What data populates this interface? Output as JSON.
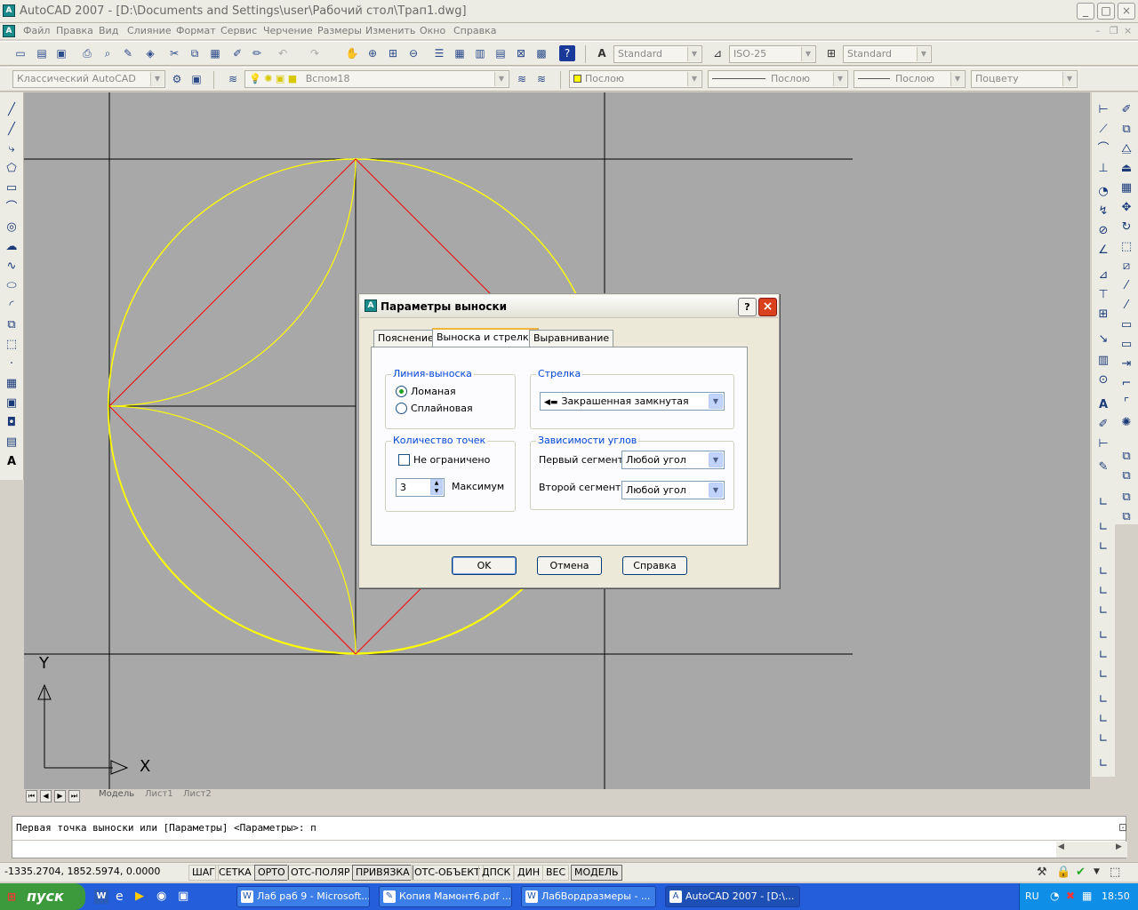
{
  "app": {
    "title": "AutoCAD 2007 - [D:\\Documents and Settings\\user\\Рабочий стол\\Трап1.dwg]",
    "icon": "autocad-app-icon"
  },
  "menu": [
    "Файл",
    "Правка",
    "Вид",
    "Слияние",
    "Формат",
    "Сервис",
    "Черчение",
    "Размеры",
    "Изменить",
    "Окно",
    "Справка"
  ],
  "toolbar": {
    "text_style": "Standard",
    "dim_style": "ISO-25",
    "table_style": "Standard",
    "workspace": "Классический AutoCAD",
    "layer": "Вспом18",
    "color": "Послою",
    "linetype": "Послою",
    "lineweight": "Послою",
    "plotstyle": "Поцвету"
  },
  "layout_tabs": [
    "Модель",
    "Лист1",
    "Лист2"
  ],
  "ucs": {
    "y": "Y",
    "x": "X"
  },
  "command_line": "Первая точка выноски или [Параметры] <Параметры>: п",
  "status": {
    "coords": "-1335.2704, 1852.5974, 0.0000",
    "buttons": [
      {
        "label": "ШАГ",
        "on": false
      },
      {
        "label": "СЕТКА",
        "on": false
      },
      {
        "label": "ОРТО",
        "on": true
      },
      {
        "label": "ОТС-ПОЛЯР",
        "on": false
      },
      {
        "label": "ПРИВЯЗКА",
        "on": true
      },
      {
        "label": "ОТС-ОБЪЕКТ",
        "on": false
      },
      {
        "label": "ДПСК",
        "on": false
      },
      {
        "label": "ДИН",
        "on": false
      },
      {
        "label": "ВЕС",
        "on": false
      },
      {
        "label": "МОДЕЛЬ",
        "on": true
      }
    ]
  },
  "taskbar": {
    "start": "пуск",
    "tasks": [
      "Лаб раб 9 - Microsoft...",
      "Копия Мамонт6.pdf ...",
      "ЛабВордразмеры - ...",
      "AutoCAD 2007 - [D:\\..."
    ],
    "lang": "RU",
    "time": "18:50"
  },
  "dialog": {
    "title": "Параметры выноски",
    "tabs": [
      "Пояснение",
      "Выноска и стрелка",
      "Выравнивание"
    ],
    "leader_group": "Линия-выноска",
    "leader_opt1": "Ломаная",
    "leader_opt2": "Сплайновая",
    "arrow_group": "Стрелка",
    "arrow_value": "Закрашенная замкнутая",
    "points_group": "Количество точек",
    "unlimited": "Не ограничено",
    "points_value": "3",
    "maximum": "Максимум",
    "angles_group": "Зависимости углов",
    "first_seg": "Первый сегмент:",
    "second_seg": "Второй сегмент:",
    "angle_value1": "Любой угол",
    "angle_value2": "Любой угол",
    "ok": "OK",
    "cancel": "Отмена",
    "help": "Справка",
    "help_icon": "?",
    "close_icon": "×"
  },
  "colors": {
    "canvas": "#a8a8a8",
    "circle": "#ffff00",
    "diamond": "#ff0000",
    "axis": "#000000"
  }
}
